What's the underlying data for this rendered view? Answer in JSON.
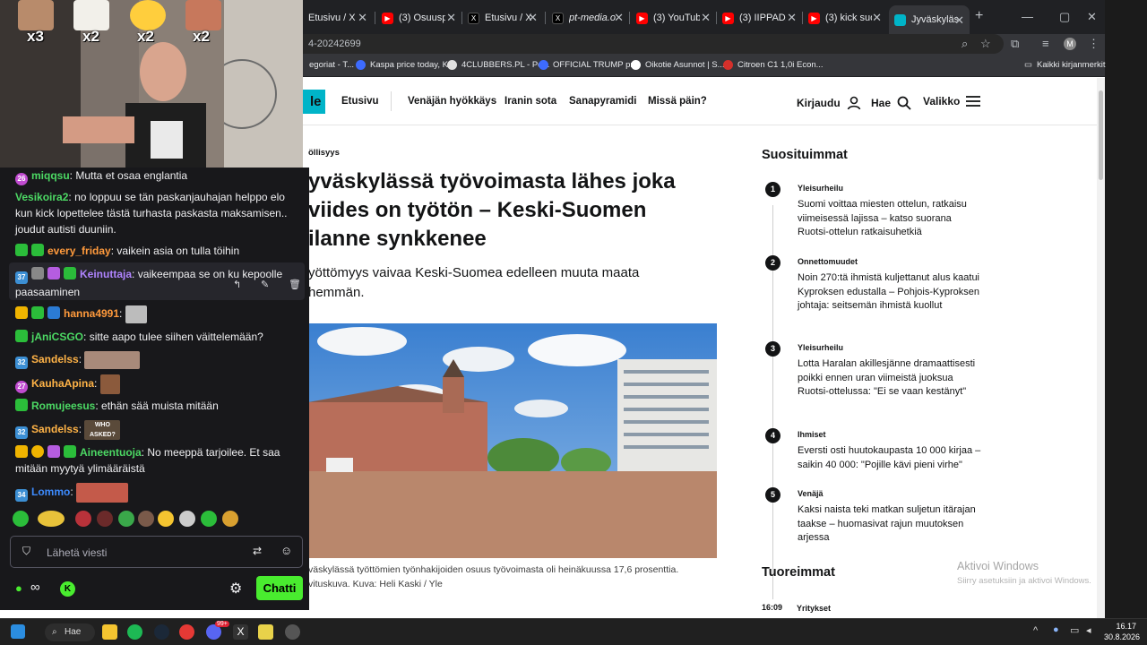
{
  "browser": {
    "tabs": [
      {
        "title": "Etusivu / X",
        "color": "#000000"
      },
      {
        "title": "(3) Osuuspankki",
        "color": "#ff0000"
      },
      {
        "title": "Etusivu / X",
        "color": "#000000"
      },
      {
        "title": "pt-media.org",
        "color": "#000000"
      },
      {
        "title": "(3) YouTube",
        "color": "#ff0000"
      },
      {
        "title": "(3) IIPPADAA",
        "color": "#ff0000"
      },
      {
        "title": "(3) kick suom",
        "color": "#ff0000"
      },
      {
        "title": "Jyväskylässä t",
        "color": "#00b4c8"
      }
    ],
    "url": "4-20242699",
    "bookmarks": [
      "egoriat - T...",
      "Kaspa price today, K...",
      "4CLUBBERS.PL - Po...",
      "OFFICIAL TRUMP pr...",
      "Oikotie Asunnot | S...",
      "Citroen C1 1,0i Econ..."
    ],
    "all_bookmarks": "Kaikki kirjanmerkit",
    "profile_initial": "M"
  },
  "yle": {
    "logo": "le",
    "nav": [
      "Etusivu",
      "Venäjän hyökkäys",
      "Iranin sota",
      "Sanapyramidi",
      "Missä päin?"
    ],
    "login": "Kirjaudu",
    "search": "Hae",
    "menu": "Valikko",
    "article": {
      "category": "öllisyys",
      "headline": "yväskylässä työvoimasta lähes joka viides on työtön – Keski-Suomen ilanne synkkenee",
      "lead": "yöttömyys vaivaa Keski-Suomea edelleen muuta maata hemmän.",
      "caption": "väskylässä työttömien työnhakijoiden osuus työvoimasta oli heinäkuussa 17,6 prosenttia. vituskuva. Kuva: Heli Kaski / Yle"
    },
    "popular_title": "Suosituimmat",
    "popular": [
      {
        "num": "1",
        "category": "Yleisurheilu",
        "text": "Suomi voittaa miesten ottelun, ratkaisu viimeisessä lajissa – katso suorana Ruotsi-ottelun ratkaisuhetkiä"
      },
      {
        "num": "2",
        "category": "Onnettomuudet",
        "text": "Noin 270:tä ihmistä kuljettanut alus kaatui Kyproksen edustalla – Pohjois-Kyproksen johtaja: seitsemän ihmistä kuollut"
      },
      {
        "num": "3",
        "category": "Yleisurheilu",
        "text": "Lotta Haralan akillesjänne dramaattisesti poikki ennen uran viimeistä juoksua Ruotsi-ottelussa: \"Ei se vaan kestänyt\""
      },
      {
        "num": "4",
        "category": "Ihmiset",
        "text": "Eversti osti huutokaupasta 10 000 kirjaa – saikin 40 000: \"Pojille kävi pieni virhe\""
      },
      {
        "num": "5",
        "category": "Venäjä",
        "text": "Kaksi naista teki matkan suljetun itärajan taakse – huomasivat rajun muutoksen arjessa"
      }
    ],
    "latest_title": "Tuoreimmat",
    "latest_time": "16:09",
    "latest_category": "Yritykset"
  },
  "windows_watermark": {
    "title": "Aktivoi Windows",
    "subtitle": "Siirry asetuksiin ja aktivoi Windows."
  },
  "cam": {
    "counters": [
      "x3",
      "x2",
      "x2",
      "x2"
    ]
  },
  "chat": {
    "messages": [
      {
        "user": "miqqsu",
        "color": "#4cd964",
        "badge": "26",
        "text": "Mutta et osaa englantia"
      },
      {
        "user": "Vesikoira2",
        "color": "#4cd964",
        "text": "no loppuu se tän paskanjauhajan helppo elo kun kick lopettelee tästä turhasta paskasta maksamisen.. joudut autisti duuniin."
      },
      {
        "user": "every_friday",
        "color": "#ff9a3c",
        "text": "vaikein asia on tulla töihin"
      },
      {
        "user": "Keinuttaja",
        "color": "#b084ff",
        "badge": "37",
        "text": "vaikeempaa se on ku kepoolle paasaaminen"
      },
      {
        "user": "hanna4991",
        "color": "#ff9a3c",
        "text": ""
      },
      {
        "user": "jAniCSGO",
        "color": "#4cd964",
        "text": "sitte aapo tulee siihen väittelemään?"
      },
      {
        "user": "Sandelss",
        "color": "#ffb347",
        "badge": "32",
        "text": ""
      },
      {
        "user": "KauhaApina",
        "color": "#ffb347",
        "badge": "27",
        "text": ""
      },
      {
        "user": "Romujeesus",
        "color": "#4cd964",
        "text": "ethän sää muista mitään"
      },
      {
        "user": "Sandelss",
        "color": "#ffb347",
        "badge": "32",
        "text": ""
      },
      {
        "user": "Aineentuoja",
        "color": "#4cd964",
        "text": "No meeppä tarjoilee. Et saa mitään myytyä ylimääräistä"
      },
      {
        "user": "Lommo",
        "color": "#3d8bff",
        "badge": "34",
        "text": ""
      }
    ],
    "emote_label": "WHO ASKED?",
    "input_placeholder": "Lähetä viesti",
    "send": "Chatti"
  },
  "taskbar": {
    "search": "Hae",
    "time": "16.17",
    "date": "30.8.2026",
    "badge": "99+"
  }
}
